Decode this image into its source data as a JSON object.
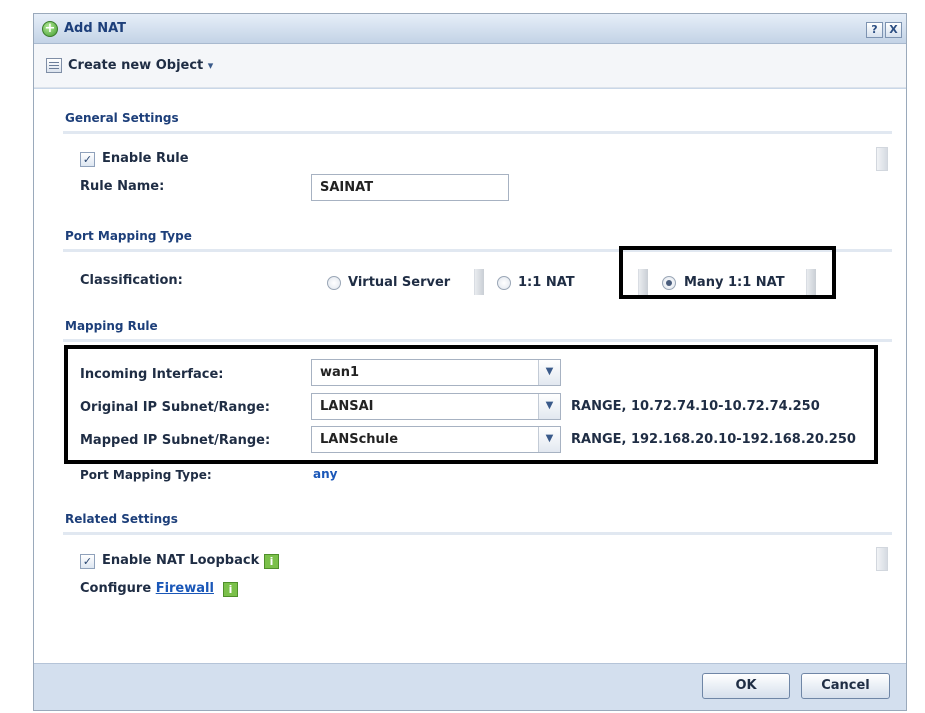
{
  "dialog": {
    "title": "Add NAT",
    "help_label": "?",
    "close_label": "X"
  },
  "toolbar": {
    "create_label": "Create new Object",
    "dropdown_arrow": "▾"
  },
  "general": {
    "section_title": "General Settings",
    "enable_rule_label": "Enable Rule",
    "enable_rule_checked": true,
    "rule_name_label": "Rule Name:",
    "rule_name_value": "SAINAT"
  },
  "port_mapping": {
    "section_title": "Port Mapping Type",
    "classification_label": "Classification:",
    "options": [
      {
        "label": "Virtual Server",
        "selected": false
      },
      {
        "label": "1:1 NAT",
        "selected": false
      },
      {
        "label": "Many 1:1 NAT",
        "selected": true
      }
    ]
  },
  "mapping_rule": {
    "section_title": "Mapping Rule",
    "incoming_label": "Incoming Interface:",
    "incoming_value": "wan1",
    "original_label": "Original IP Subnet/Range:",
    "original_value": "LANSAI",
    "original_range": "RANGE, 10.72.74.10-10.72.74.250",
    "mapped_label": "Mapped IP Subnet/Range:",
    "mapped_value": "LANSchule",
    "mapped_range": "RANGE, 192.168.20.10-192.168.20.250",
    "port_type_label": "Port Mapping Type:",
    "port_type_value": "any"
  },
  "related": {
    "section_title": "Related Settings",
    "loopback_label": "Enable NAT Loopback",
    "loopback_checked": true,
    "configure_label": "Configure",
    "firewall_link": "Firewall",
    "info_glyph": "i"
  },
  "footer": {
    "ok_label": "OK",
    "cancel_label": "Cancel"
  },
  "colors": {
    "section_title": "#1d3f7a",
    "link": "#1a57b8",
    "info_icon": "#7bc04a",
    "highlight_border": "#000000"
  },
  "icons": {
    "title": "add-circle-icon",
    "toolbar": "object-list-icon",
    "info": "info-icon"
  }
}
